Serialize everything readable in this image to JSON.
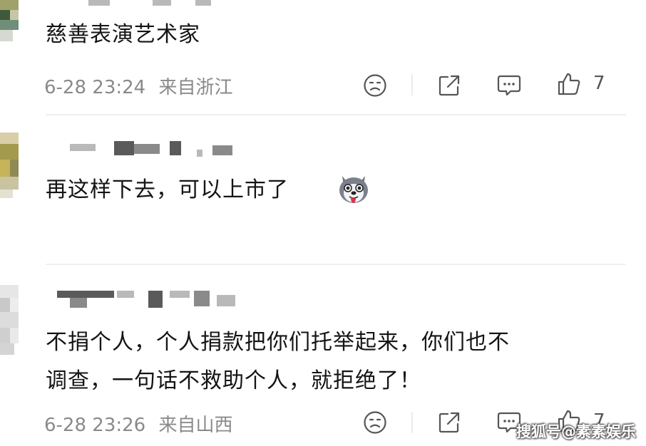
{
  "comments": [
    {
      "text": "慈善表演艺术家",
      "time": "6-28 23:24",
      "location": "来自浙江",
      "likes": "7"
    },
    {
      "text": "再这样下去，可以上市了",
      "emoji": "husky-emoji"
    },
    {
      "line1": "不捐个人，个人捐款把你们托举起来，你们也不",
      "line2": "调查，一句话不救助个人，就拒绝了！",
      "time": "6-28 23:26",
      "location": "来自山西",
      "likes": "7"
    }
  ],
  "watermark": "搜狐号@素素娱乐",
  "colors": {
    "text": "#141414",
    "meta": "#8a8a8a",
    "divider": "#efefef"
  }
}
